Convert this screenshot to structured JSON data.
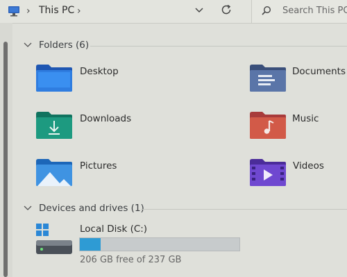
{
  "address": {
    "location": "This PC"
  },
  "search": {
    "placeholder": "Search This PC"
  },
  "sections": {
    "folders": {
      "label": "Folders (6)"
    },
    "devices": {
      "label": "Devices and drives (1)"
    }
  },
  "folders": [
    {
      "label": "Desktop",
      "icon": "desktop-folder-icon"
    },
    {
      "label": "Documents",
      "icon": "documents-folder-icon"
    },
    {
      "label": "Downloads",
      "icon": "downloads-folder-icon"
    },
    {
      "label": "Music",
      "icon": "music-folder-icon"
    },
    {
      "label": "Pictures",
      "icon": "pictures-folder-icon"
    },
    {
      "label": "Videos",
      "icon": "videos-folder-icon"
    }
  ],
  "drive": {
    "name": "Local Disk (C:)",
    "free_text": "206 GB free of 237 GB",
    "used_fraction": 0.13
  },
  "colors": {
    "accent": "#2e9bd4"
  }
}
